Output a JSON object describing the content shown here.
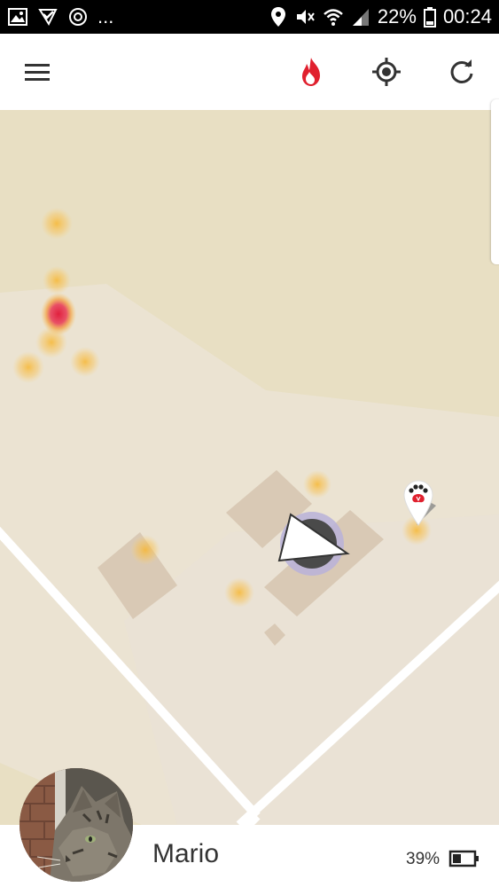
{
  "status_bar": {
    "battery_percent": "22%",
    "time": "00:24",
    "overflow": "...",
    "icons": [
      "gallery-icon",
      "check-download-icon",
      "sync-icon",
      "location-pin-icon",
      "mute-icon",
      "wifi-icon",
      "signal-icon",
      "battery-icon"
    ]
  },
  "app_bar": {
    "icons": [
      "menu-icon",
      "heatmap-flame-icon",
      "locate-icon",
      "refresh-icon"
    ],
    "accent_color": "#e0202e"
  },
  "map": {
    "colors": {
      "land": "#e8dfc3",
      "area": "#ebe3d2",
      "road": "#ffffff",
      "building": "#d9c9b5"
    },
    "heat_points": 11,
    "pet_marker_icon": "paw-pin-icon",
    "direction_icon": "navigation-arrow-icon"
  },
  "pet": {
    "name": "Mario",
    "tracker_battery": "39%",
    "battery_icon": "battery-low-icon",
    "avatar": "cat-avatar"
  }
}
